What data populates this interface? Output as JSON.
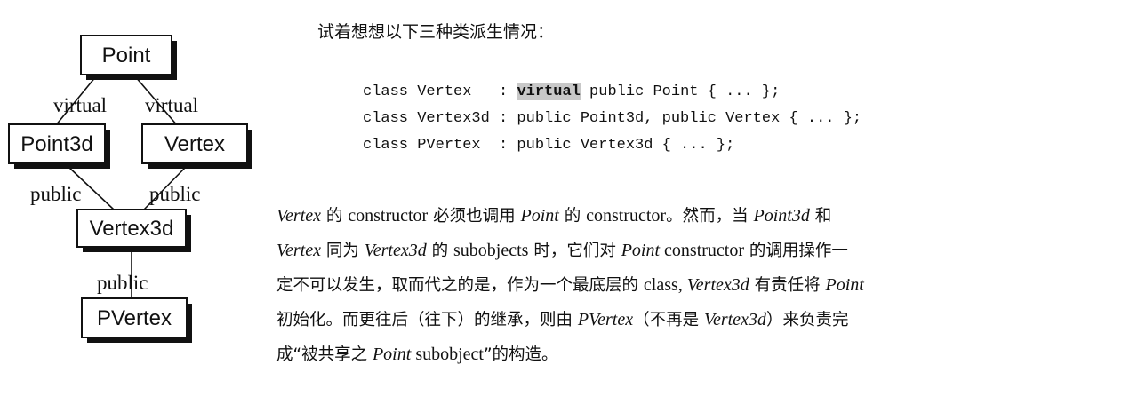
{
  "diagram": {
    "nodes": {
      "point": "Point",
      "point3d": "Point3d",
      "vertex": "Vertex",
      "vertex3d": "Vertex3d",
      "pvertex": "PVertex"
    },
    "edges": {
      "point3d_point": "virtual",
      "vertex_point": "virtual",
      "vertex3d_point3d": "public",
      "vertex3d_vertex": "public",
      "pvertex_vertex3d": "public"
    }
  },
  "intro": "试着想想以下三种类派生情况：",
  "code": {
    "line1_pre": "class Vertex   : ",
    "line1_kw": "virtual",
    "line1_post": " public Point { ... };",
    "line2": "class Vertex3d : public Point3d, public Vertex { ... };",
    "line3": "class PVertex  : public Vertex3d { ... };"
  },
  "paragraph": {
    "l1": [
      {
        "t": "Vertex",
        "s": "i"
      },
      {
        "t": " 的 ",
        "s": "cn"
      },
      {
        "t": "constructor",
        "s": "r"
      },
      {
        "t": " 必须也调用 ",
        "s": "cn"
      },
      {
        "t": "Point",
        "s": "i"
      },
      {
        "t": " 的 ",
        "s": "cn"
      },
      {
        "t": "constructor",
        "s": "r"
      },
      {
        "t": "。然而，当 ",
        "s": "cn"
      },
      {
        "t": "Point3d",
        "s": "i"
      },
      {
        "t": " 和",
        "s": "cn"
      }
    ],
    "l2": [
      {
        "t": "Vertex",
        "s": "i"
      },
      {
        "t": " 同为 ",
        "s": "cn"
      },
      {
        "t": "Vertex3d",
        "s": "i"
      },
      {
        "t": " 的 ",
        "s": "cn"
      },
      {
        "t": "subobjects",
        "s": "r"
      },
      {
        "t": " 时，它们对 ",
        "s": "cn"
      },
      {
        "t": "Point",
        "s": "i"
      },
      {
        "t": " constructor",
        "s": "r"
      },
      {
        "t": " 的调用操作一",
        "s": "cn"
      }
    ],
    "l3": [
      {
        "t": "定不可以发生，取而代之的是，作为一个最底层的 ",
        "s": "cn"
      },
      {
        "t": "class,",
        "s": "r"
      },
      {
        "t": " Vertex3d",
        "s": "i"
      },
      {
        "t": " 有责任将 ",
        "s": "cn"
      },
      {
        "t": "Point",
        "s": "i"
      }
    ],
    "l4": [
      {
        "t": "初始化。而更往后（往下）的继承，则由 ",
        "s": "cn"
      },
      {
        "t": "PVertex",
        "s": "i"
      },
      {
        "t": "（不再是 ",
        "s": "cn"
      },
      {
        "t": "Vertex3d",
        "s": "i"
      },
      {
        "t": "）来负责完",
        "s": "cn"
      }
    ],
    "l5": [
      {
        "t": "成“被共享之 ",
        "s": "cn"
      },
      {
        "t": "Point",
        "s": "i"
      },
      {
        "t": " subobject",
        "s": "r"
      },
      {
        "t": "”的构造。",
        "s": "cn"
      }
    ]
  }
}
